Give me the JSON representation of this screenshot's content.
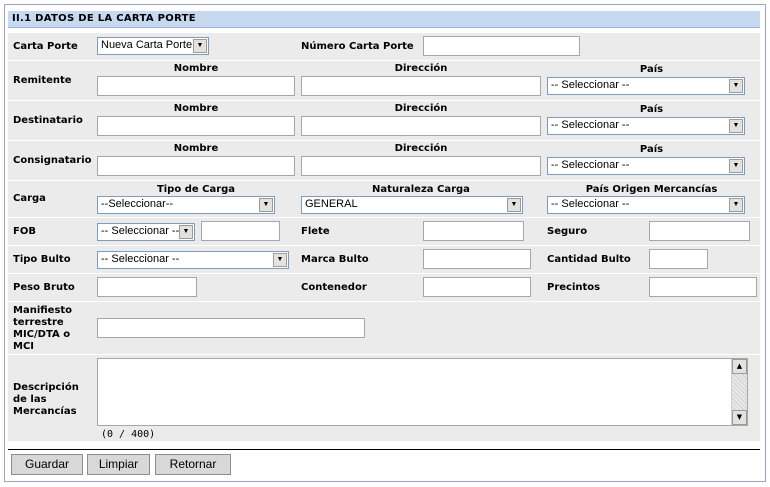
{
  "section": {
    "title": "II.1 DATOS DE LA CARTA PORTE"
  },
  "carta_porte": {
    "label": "Carta Porte",
    "selected": "Nueva Carta Porte"
  },
  "numero_carta_porte": {
    "label": "Número Carta Porte",
    "value": ""
  },
  "columns": {
    "nombre": "Nombre",
    "direccion": "Dirección",
    "pais": "País"
  },
  "remitente": {
    "label": "Remitente",
    "pais_selected": "-- Seleccionar --"
  },
  "destinatario": {
    "label": "Destinatario",
    "pais_selected": "-- Seleccionar --"
  },
  "consignatario": {
    "label": "Consignatario",
    "pais_selected": "-- Seleccionar --"
  },
  "carga": {
    "label": "Carga",
    "tipo_label": "Tipo de Carga",
    "tipo_selected": "--Seleccionar--",
    "naturaleza_label": "Naturaleza Carga",
    "naturaleza_selected": "GENERAL",
    "origen_label": "País Origen Mercancías",
    "origen_selected": "-- Seleccionar --"
  },
  "fob": {
    "label": "FOB",
    "selected": "-- Seleccionar --"
  },
  "flete": {
    "label": "Flete"
  },
  "seguro": {
    "label": "Seguro"
  },
  "tipo_bulto": {
    "label": "Tipo Bulto",
    "selected": "-- Seleccionar --"
  },
  "marca_bulto": {
    "label": "Marca Bulto"
  },
  "cantidad_bulto": {
    "label": "Cantidad Bulto"
  },
  "peso_bruto": {
    "label": "Peso Bruto"
  },
  "contenedor": {
    "label": "Contenedor"
  },
  "precintos": {
    "label": "Precintos"
  },
  "manifiesto": {
    "label_lines": [
      "Manifiesto",
      "terrestre",
      "MIC/DTA o",
      "MCI"
    ]
  },
  "descripcion": {
    "label_lines": [
      "Descripción",
      "de las",
      "Mercancías"
    ],
    "counter": "(0 / 400)"
  },
  "buttons": {
    "guardar": "Guardar",
    "limpiar": "Limpiar",
    "retornar": "Retornar"
  }
}
